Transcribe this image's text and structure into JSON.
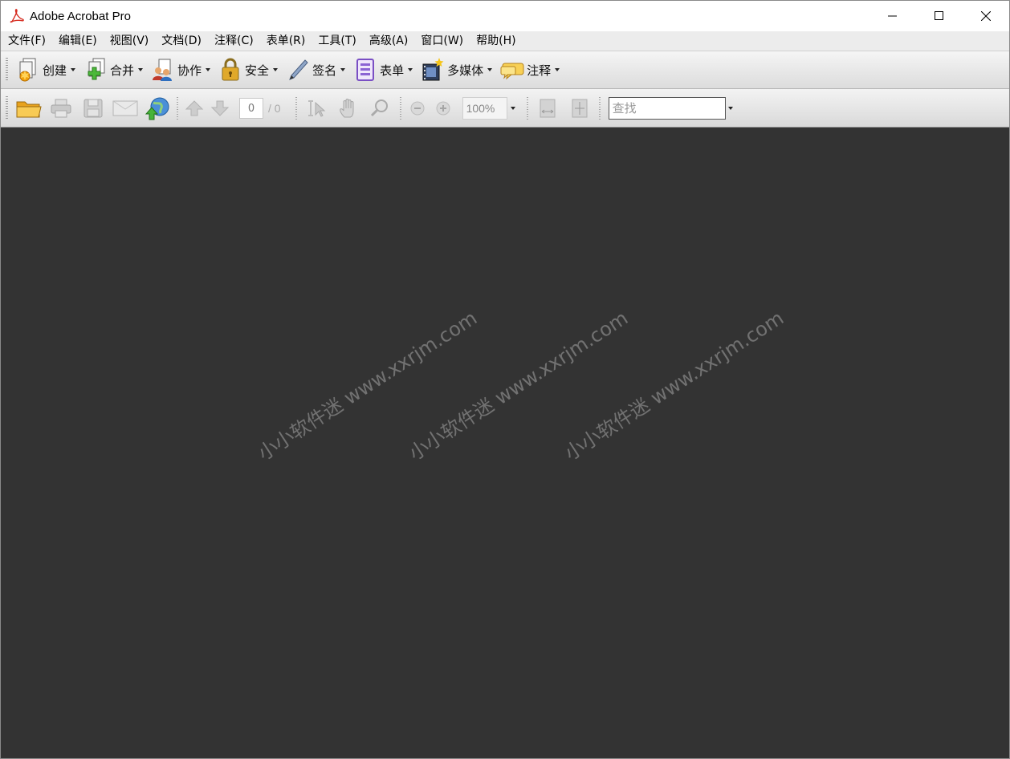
{
  "window": {
    "title": "Adobe Acrobat Pro"
  },
  "menu": [
    "文件(F)",
    "编辑(E)",
    "视图(V)",
    "文档(D)",
    "注释(C)",
    "表单(R)",
    "工具(T)",
    "高级(A)",
    "窗口(W)",
    "帮助(H)"
  ],
  "tasks": [
    {
      "label": "创建",
      "icon": "create-pdf-icon"
    },
    {
      "label": "合并",
      "icon": "combine-icon"
    },
    {
      "label": "协作",
      "icon": "collaborate-icon"
    },
    {
      "label": "安全",
      "icon": "lock-icon"
    },
    {
      "label": "签名",
      "icon": "pen-icon"
    },
    {
      "label": "表单",
      "icon": "form-icon"
    },
    {
      "label": "多媒体",
      "icon": "multimedia-icon"
    },
    {
      "label": "注释",
      "icon": "comment-icon"
    }
  ],
  "navigation": {
    "current_page": "0",
    "total_pages": "/ 0",
    "zoom": "100%"
  },
  "search": {
    "placeholder": "查找"
  },
  "watermark": {
    "text": "小小软件迷 www.xxrjm.com"
  },
  "colors": {
    "document_background": "#333333",
    "acrobat_red": "#d62a1e"
  }
}
